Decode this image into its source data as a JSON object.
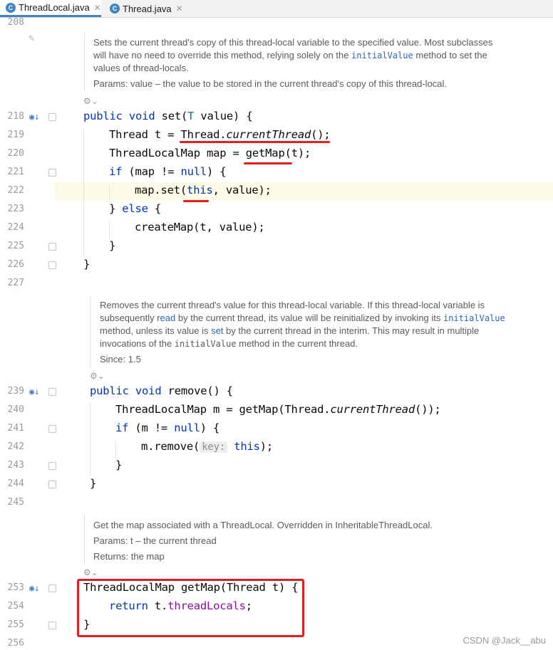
{
  "tabs": [
    {
      "label": "ThreadLocal.java",
      "icon": "C"
    },
    {
      "label": "Thread.java",
      "icon": "C"
    }
  ],
  "line_numbers": [
    "208",
    "218",
    "219",
    "220",
    "221",
    "222",
    "223",
    "224",
    "225",
    "226",
    "227",
    "239",
    "240",
    "241",
    "242",
    "243",
    "244",
    "245",
    "253",
    "254",
    "255",
    "256"
  ],
  "doc_set": {
    "l1": "Sets the current thread's copy of this thread-local variable to the specified value. Most subclasses",
    "l2": "will have no need to override this method, relying solely on the ",
    "l2_code": "initialValue",
    "l2_end": " method to set the",
    "l3": "values of thread-locals.",
    "params": "Params: value – the value to be stored in the current thread's copy of this thread-local."
  },
  "doc_remove": {
    "l1": "Removes the current thread's value for this thread-local variable. If this thread-local variable is",
    "l2a": "subsequently ",
    "l2_link": "read",
    "l2b": " by the current thread, its value will be reinitialized by invoking its ",
    "l2_code": "initialValue",
    "l3a": "method, unless its value is ",
    "l3_link": "set",
    "l3b": " by the current thread in the interim. This may result in multiple",
    "l4a": "invocations of the ",
    "l4_code": "initialValue",
    "l4b": " method in the current thread.",
    "since": "Since: 1.5"
  },
  "doc_getmap": {
    "l1": "Get the map associated with a ThreadLocal. Overridden in InheritableThreadLocal.",
    "params": "Params:  t – the current thread",
    "returns": "Returns: the map"
  },
  "code": {
    "s1_kw": "public void ",
    "s1_name": "set(",
    "s1_type": "T",
    "s1_rest": " value) {",
    "s2_a": "Thread t = ",
    "s2_b": "Thread.",
    "s2_c": "currentThread",
    "s2_d": "();",
    "s3_a": "ThreadLocalMap map = ",
    "s3_b": "getMap",
    "s3_c": "(t);",
    "s4_kw": "if",
    "s4_a": " (map != ",
    "s4_null": "null",
    "s4_b": ") {",
    "s5_a": "map.set(",
    "s5_this": "this",
    "s5_b": ", value);",
    "s6_a": "} ",
    "s6_kw": "else",
    "s6_b": " {",
    "s7": "createMap(t, value);",
    "s8": "}",
    "s9": "}",
    "r1_kw": "public void ",
    "r1_rest": "remove() {",
    "r2_a": "ThreadLocalMap m = getMap(Thread.",
    "r2_it": "currentThread",
    "r2_b": "());",
    "r3_kw": "if",
    "r3_a": " (m != ",
    "r3_null": "null",
    "r3_b": ") {",
    "r4_a": "m.remove(",
    "r4_hint": "key:",
    "r4_this": "this",
    "r4_b": ");",
    "r5": "}",
    "r6": "}",
    "g1": "ThreadLocalMap getMap(Thread t) {",
    "g2_kw": "return",
    "g2_a": " t.",
    "g2_field": "threadLocals",
    "g2_b": ";",
    "g3": "}"
  },
  "watermark": "CSDN @Jack__abu",
  "colors": {
    "annotation_red": "#e0211f",
    "keyword": "#0033b3",
    "field": "#871094",
    "current_line": "#fdfbe6"
  }
}
